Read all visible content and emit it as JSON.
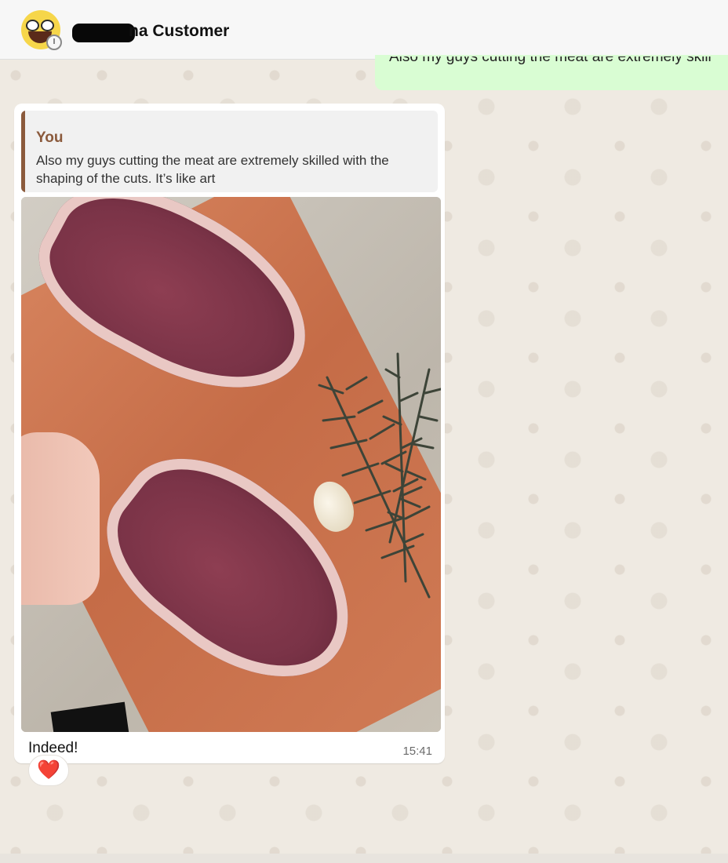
{
  "header": {
    "contact_name": "na Customer",
    "avatar_icon": "laughing-face-emoji",
    "status_icon": "clock-icon"
  },
  "outgoing_preview": {
    "text": "Also my guys cutting the meat are extremely skill"
  },
  "message": {
    "quote": {
      "author": "You",
      "text": "Also my guys cutting the meat are extremely skilled with the shaping of the cuts. It’s like art"
    },
    "image_description_icon": "photo-steaks-on-cutting-board",
    "text": "Indeed!",
    "time": "15:41",
    "reaction": "❤️"
  },
  "colors": {
    "header_bg": "#f7f7f7",
    "chat_bg": "#efeae2",
    "outgoing_bubble": "#d9fdd3",
    "incoming_bubble": "#ffffff",
    "quote_accent": "#8b5a3c"
  }
}
